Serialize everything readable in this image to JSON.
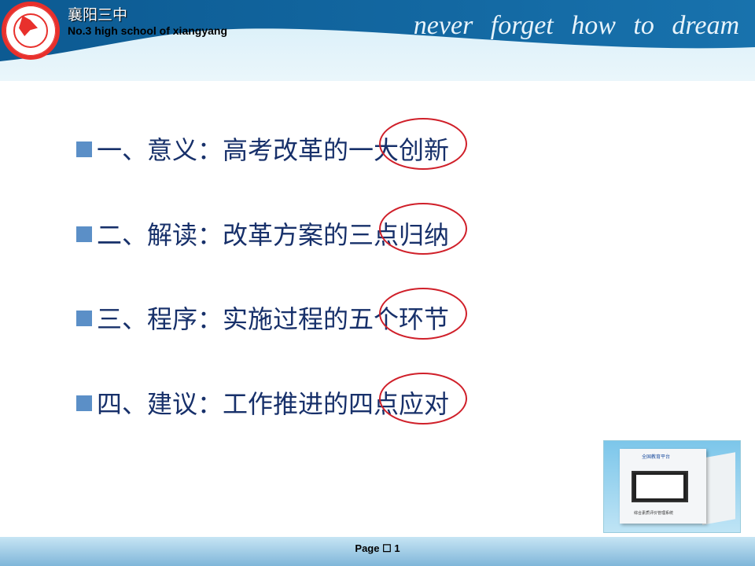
{
  "header": {
    "school_name_cn": "襄阳三中",
    "school_name_en": "No.3 high school of xiangyang",
    "slogan": "never forget  how to dream",
    "logo_icon": "school-seal-logo"
  },
  "items": [
    {
      "label": "一、意义：高考改革的一大创新"
    },
    {
      "label": "二、解读：改革方案的三点归纳"
    },
    {
      "label": "三、程序：实施过程的五个环节"
    },
    {
      "label": "四、建议：工作推进的四点应对"
    }
  ],
  "image": {
    "platform_title": "全国教育平台",
    "system_name": "综合素质评价管理系统"
  },
  "footer": {
    "page_label": "Page ☐ 1"
  },
  "colors": {
    "header_blue": "#0d5c93",
    "text": "#17306a",
    "bullet": "#5b8fc7",
    "ring": "#d0202a"
  }
}
